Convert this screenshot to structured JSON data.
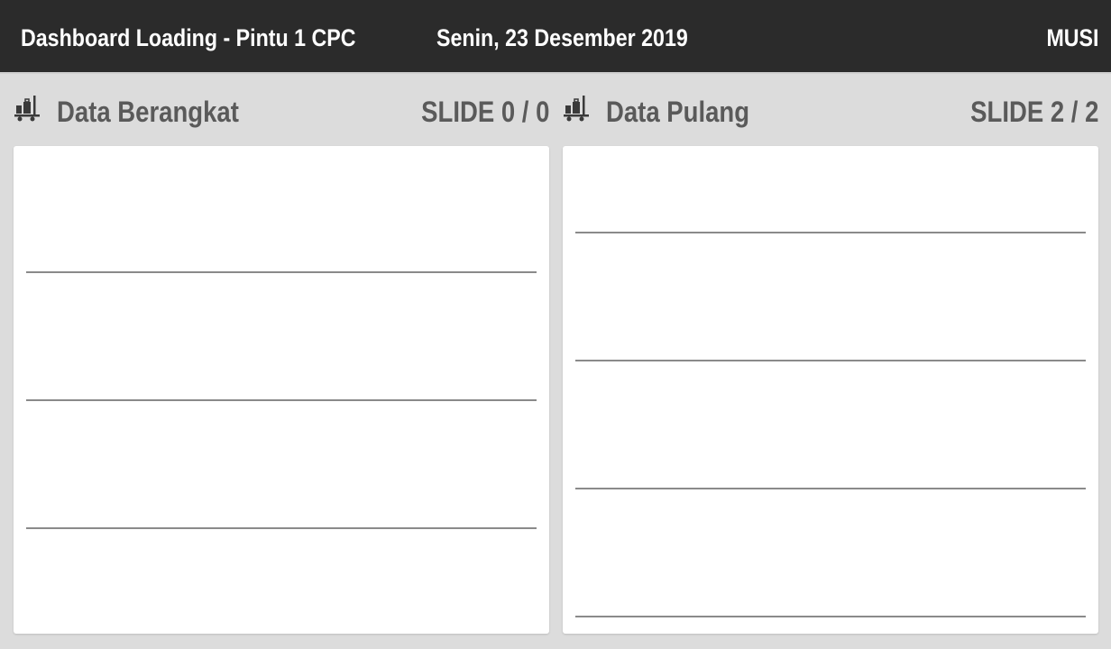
{
  "header": {
    "title": "Dashboard Loading - Pintu 1 CPC",
    "date": "Senin, 23 Desember 2019",
    "user": "MUSI"
  },
  "sections": [
    {
      "label": "Data Berangkat",
      "slide": "SLIDE 0 / 0",
      "icon": "luggage-cart-icon",
      "row_count": 3
    },
    {
      "label": "Data Pulang",
      "slide": "SLIDE 2 / 2",
      "icon": "luggage-cart-icon",
      "row_count": 4
    }
  ],
  "colors": {
    "header_bg": "#2b2b2b",
    "header_text": "#ffffff",
    "page_bg": "#dcdcdc",
    "panel_bg": "#ffffff",
    "section_text": "#5a5a5a",
    "divider": "#8a8a8a"
  }
}
